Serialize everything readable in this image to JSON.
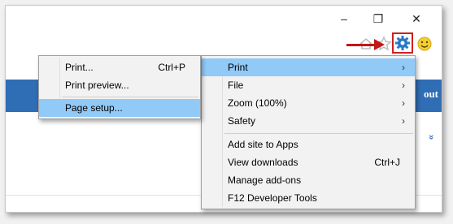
{
  "window": {
    "minimize_glyph": "–",
    "restore_glyph": "❐",
    "close_glyph": "✕"
  },
  "toolbar": {
    "icons": [
      "home-icon",
      "favorites-star-icon",
      "tools-gear-icon",
      "smiley-feedback-icon"
    ],
    "highlight_color": "#d02020",
    "gear_color": "#2a78c8"
  },
  "page": {
    "header_partial_text": "out",
    "header_color": "#2f6db5",
    "expand_glyph": "»"
  },
  "tools_menu": {
    "items": [
      {
        "label": "Print",
        "has_submenu": true,
        "highlighted": true
      },
      {
        "label": "File",
        "has_submenu": true
      },
      {
        "label": "Zoom (100%)",
        "has_submenu": true
      },
      {
        "label": "Safety",
        "has_submenu": true
      },
      {
        "label": "Add site to Apps"
      },
      {
        "label": "View downloads",
        "shortcut": "Ctrl+J"
      },
      {
        "label": "Manage add-ons"
      },
      {
        "label": "F12 Developer Tools"
      }
    ],
    "submenu_arrow": "›"
  },
  "print_submenu": {
    "items": [
      {
        "label": "Print...",
        "shortcut": "Ctrl+P"
      },
      {
        "label": "Print preview..."
      },
      {
        "label": "Page setup...",
        "highlighted": true
      }
    ]
  },
  "colors": {
    "menu_highlight": "#91c9f7",
    "annotation_arrow": "#c01818"
  }
}
